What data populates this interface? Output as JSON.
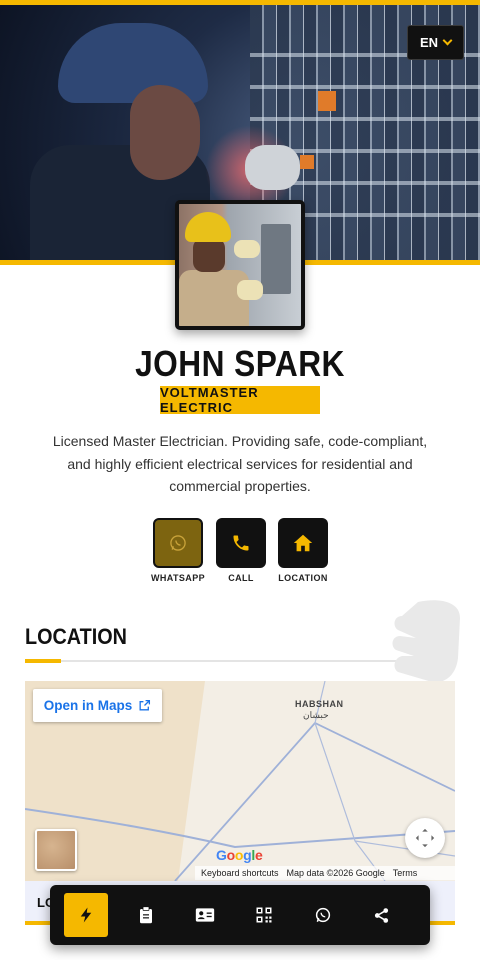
{
  "language": {
    "current": "EN"
  },
  "profile": {
    "name": "JOHN SPARK",
    "company": "VOLTMASTER ELECTRIC",
    "bio": "Licensed Master Electrician. Providing safe, code-compliant, and highly efficient electrical services for residential and commercial properties."
  },
  "actions": [
    {
      "label": "WHATSAPP",
      "icon": "whatsapp-icon"
    },
    {
      "label": "CALL",
      "icon": "phone-icon"
    },
    {
      "label": "LOCATION",
      "icon": "home-icon"
    }
  ],
  "location": {
    "title": "LOCATION",
    "map": {
      "open_button": "Open in Maps",
      "city": "HABSHAN",
      "city_ar": "حبشان",
      "brand": "Google",
      "footer_shortcuts": "Keyboard shortcuts",
      "footer_data": "Map data ©2026 Google",
      "footer_terms": "Terms",
      "info_label": "LO"
    }
  },
  "bottom_nav": [
    {
      "icon": "bolt-icon",
      "active": true
    },
    {
      "icon": "clipboard-icon",
      "active": false
    },
    {
      "icon": "id-card-icon",
      "active": false
    },
    {
      "icon": "qr-code-icon",
      "active": false
    },
    {
      "icon": "whatsapp-icon",
      "active": false
    },
    {
      "icon": "share-icon",
      "active": false
    }
  ],
  "colors": {
    "accent": "#f5b800",
    "dark": "#111111",
    "link": "#1a73e8"
  }
}
